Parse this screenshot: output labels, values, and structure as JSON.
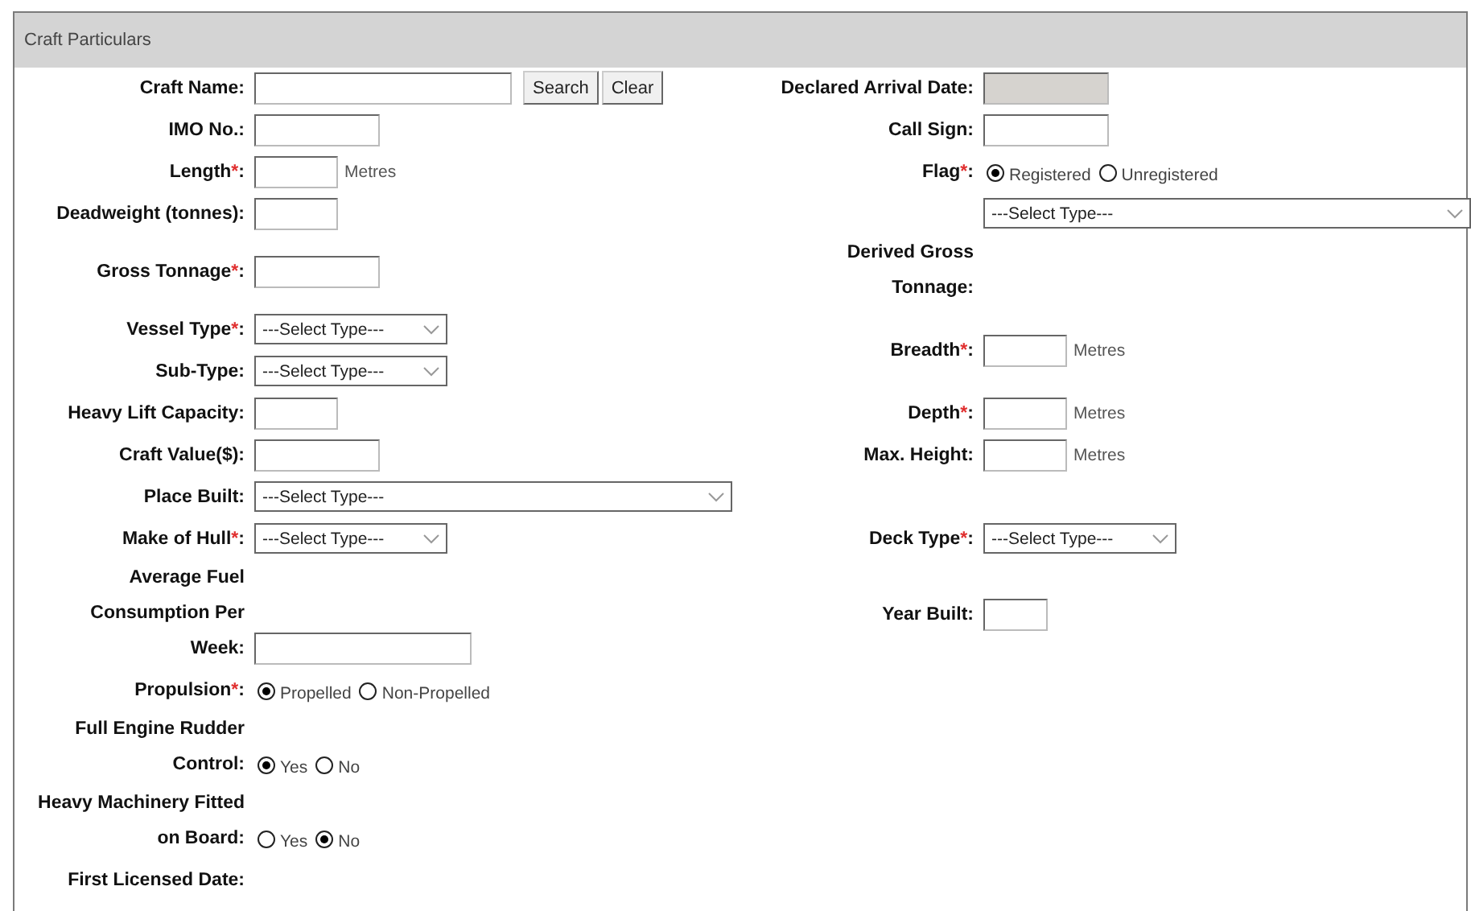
{
  "section_title": "Craft Particulars",
  "rows": [
    {
      "left": [
        {
          "label": "Craft Name:",
          "control": {
            "kind": "text",
            "disabled": false
          },
          "buttons": [
            "Search",
            "Clear"
          ]
        }
      ],
      "right": [
        {
          "label": "Declared Arrival Date:",
          "control": {
            "kind": "text",
            "disabled": true
          }
        }
      ]
    },
    {
      "left": [
        {
          "label": "IMO No.:",
          "control": {
            "kind": "text",
            "disabled": false
          }
        }
      ],
      "right": [
        {
          "label": "Call Sign:",
          "control": {
            "kind": "text",
            "disabled": false
          }
        }
      ]
    },
    {
      "left": [
        {
          "label": "Length",
          "required_mark": "*",
          "label_end": ":",
          "control": {
            "kind": "text",
            "disabled": false
          },
          "unit": "Metres"
        }
      ],
      "right": [
        {
          "label": "Flag",
          "required_mark": "*",
          "label_end": ":",
          "control": {
            "kind": "radio",
            "options": [
              {
                "label": "Registered",
                "selected": true
              },
              {
                "label": "Unregistered",
                "selected": false
              }
            ]
          }
        }
      ]
    },
    {
      "left": [
        {
          "label": "Deadweight (tonnes):",
          "control": {
            "kind": "text",
            "disabled": false
          }
        }
      ],
      "right": [
        {
          "control": {
            "kind": "select",
            "value": "---Select Type---"
          }
        }
      ]
    },
    {
      "left": [
        {
          "label": "Gross Tonnage",
          "required_mark": "*",
          "label_end": ":",
          "control": {
            "kind": "text",
            "disabled": false
          }
        }
      ],
      "right": [
        {
          "label_lines": [
            "Derived Gross",
            "Tonnage:"
          ]
        }
      ]
    },
    {
      "left": [
        {
          "label": "Vessel Type",
          "required_mark": "*",
          "label_end": ":",
          "control": {
            "kind": "select",
            "value": "---Select Type---"
          }
        },
        {
          "label": "Sub-Type:",
          "control": {
            "kind": "select",
            "value": "---Select Type---"
          }
        }
      ],
      "right": [
        {
          "label": "Breadth",
          "required_mark": "*",
          "label_end": ":",
          "control": {
            "kind": "text",
            "disabled": false
          },
          "unit": "Metres"
        }
      ]
    },
    {
      "left": [
        {
          "label": "Heavy Lift Capacity:",
          "control": {
            "kind": "text",
            "disabled": false
          }
        }
      ],
      "right": [
        {
          "label": "Depth",
          "required_mark": "*",
          "label_end": ":",
          "control": {
            "kind": "text",
            "disabled": false
          },
          "unit": "Metres"
        }
      ]
    },
    {
      "left": [
        {
          "label": "Craft Value($):",
          "control": {
            "kind": "text",
            "disabled": false
          }
        }
      ],
      "right": [
        {
          "label": "Max. Height:",
          "control": {
            "kind": "text",
            "disabled": false
          },
          "unit": "Metres"
        }
      ]
    },
    {
      "left": [
        {
          "label": "Place Built:",
          "control": {
            "kind": "select",
            "value": "---Select Type---"
          }
        }
      ],
      "right": []
    },
    {
      "left": [
        {
          "label": "Make of Hull",
          "required_mark": "*",
          "label_end": ":",
          "control": {
            "kind": "select",
            "value": "---Select Type---"
          }
        }
      ],
      "right": [
        {
          "label": "Deck Type",
          "required_mark": "*",
          "label_end": ":",
          "control": {
            "kind": "select",
            "value": "---Select Type---"
          }
        }
      ]
    },
    {
      "left": [
        {
          "label_lines": [
            "Average Fuel",
            "Consumption Per",
            "Week:"
          ],
          "control": {
            "kind": "text",
            "disabled": false
          }
        }
      ],
      "right": [
        {
          "label": "Year Built:",
          "control": {
            "kind": "text",
            "disabled": false
          }
        }
      ]
    },
    {
      "left": [
        {
          "label": "Propulsion",
          "required_mark": "*",
          "label_end": ":",
          "control": {
            "kind": "radio",
            "options": [
              {
                "label": "Propelled",
                "selected": true
              },
              {
                "label": "Non-Propelled",
                "selected": false
              }
            ]
          }
        }
      ],
      "right": []
    },
    {
      "left": [
        {
          "label_lines": [
            "Full Engine Rudder",
            "Control:"
          ],
          "control": {
            "kind": "radio",
            "options": [
              {
                "label": "Yes",
                "selected": true
              },
              {
                "label": "No",
                "selected": false
              }
            ]
          }
        }
      ],
      "right": []
    },
    {
      "left": [
        {
          "label_lines": [
            "Heavy Machinery Fitted",
            "on Board:"
          ],
          "control": {
            "kind": "radio",
            "options": [
              {
                "label": "Yes",
                "selected": false
              },
              {
                "label": "No",
                "selected": true
              }
            ]
          }
        }
      ],
      "right": []
    },
    {
      "left": [
        {
          "label": "First Licensed Date:"
        }
      ],
      "right": []
    }
  ]
}
